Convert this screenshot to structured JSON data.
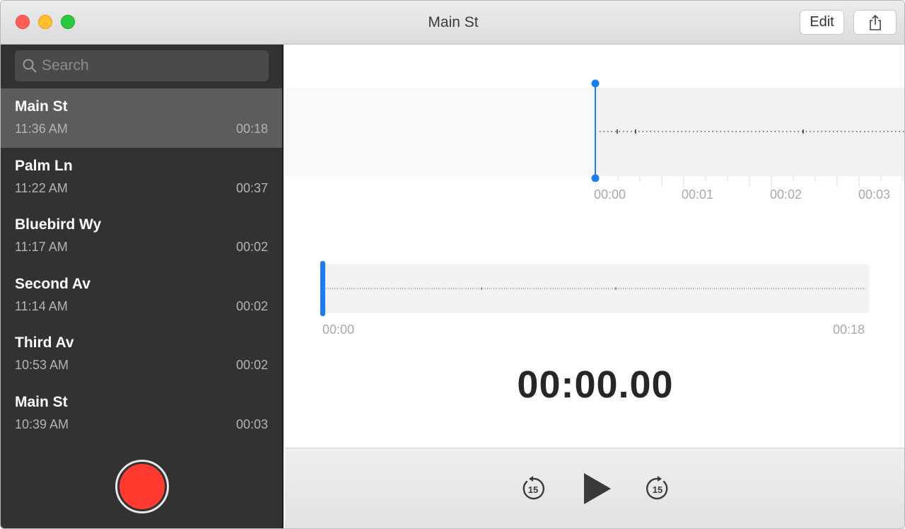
{
  "window": {
    "title": "Main St"
  },
  "toolbar": {
    "edit_label": "Edit",
    "share_icon": "share-icon"
  },
  "search": {
    "placeholder": "Search"
  },
  "recordings": [
    {
      "name": "Main St",
      "time": "11:36 AM",
      "duration": "00:18",
      "selected": true
    },
    {
      "name": "Palm Ln",
      "time": "11:22 AM",
      "duration": "00:37"
    },
    {
      "name": "Bluebird Wy",
      "time": "11:17 AM",
      "duration": "00:02"
    },
    {
      "name": "Second Av",
      "time": "11:14 AM",
      "duration": "00:02"
    },
    {
      "name": "Third Av",
      "time": "10:53 AM",
      "duration": "00:02"
    },
    {
      "name": "Main St",
      "time": "10:39 AM",
      "duration": "00:03"
    }
  ],
  "waveform": {
    "ruler": [
      "00:00",
      "00:01",
      "00:02",
      "00:03"
    ],
    "overview_start": "00:00",
    "overview_end": "00:18"
  },
  "player": {
    "timer": "00:00.00",
    "skip_back_seconds": "15",
    "skip_forward_seconds": "15"
  },
  "colors": {
    "accent": "#1a7ef2",
    "record": "#ff3b30",
    "sidebar": "#323232",
    "selected_row": "#5c5c5c"
  }
}
